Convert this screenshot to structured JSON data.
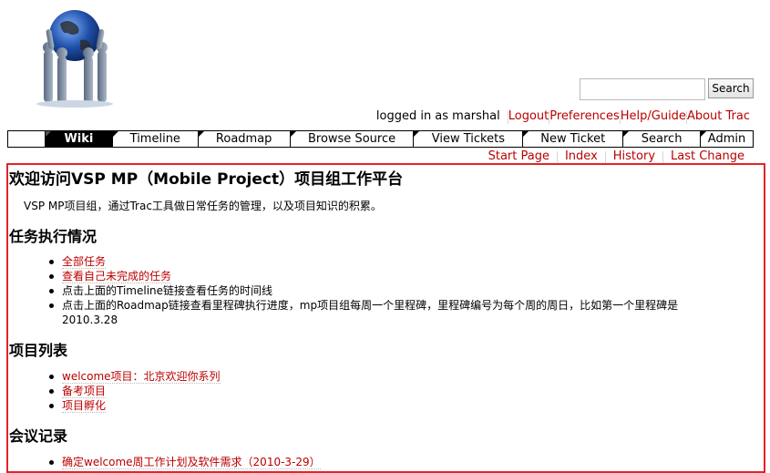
{
  "header": {
    "search_button": "Search",
    "search_placeholder": ""
  },
  "metanav": {
    "login": "logged in as marshal",
    "items": [
      "Logout",
      "Preferences",
      "Help/Guide",
      "About Trac"
    ]
  },
  "mainnav": {
    "tabs": [
      "Wiki",
      "Timeline",
      "Roadmap",
      "Browse Source",
      "View Tickets",
      "New Ticket",
      "Search",
      "Admin"
    ],
    "active": "Wiki"
  },
  "ctxtnav": {
    "items": [
      "Start Page",
      "Index",
      "History",
      "Last Change"
    ]
  },
  "content": {
    "title": "欢迎访问VSP MP（Mobile Project）项目组工作平台",
    "intro": "VSP MP项目组，通过Trac工具做日常任务的管理，以及项目知识的积累。",
    "section1": {
      "heading": "任务执行情况",
      "items": [
        "全部任务",
        "查看自己未完成的任务",
        "点击上面的Timeline链接查看任务的时间线",
        "点击上面的Roadmap链接查看里程碑执行进度，mp项目组每周一个里程碑，里程碑编号为每个周的周日，比如第一个里程碑是 2010.3.28"
      ]
    },
    "section2": {
      "heading": "项目列表",
      "items": [
        "welcome项目：北京欢迎你系列",
        "备考项目",
        "项目孵化"
      ]
    },
    "section3": {
      "heading": "会议记录",
      "items": [
        "确定welcome周工作计划及软件需求（2010-3-29）"
      ]
    }
  },
  "colors": {
    "link": "#bb0000",
    "highlight_border": "#e0242a",
    "globe_blue": "#1f4fa8"
  }
}
